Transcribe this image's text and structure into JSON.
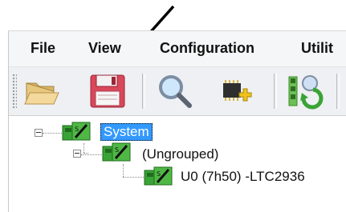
{
  "menu": {
    "file": "File",
    "view": "View",
    "configuration": "Configuration",
    "utilities": "Utilit"
  },
  "toolbar": {
    "buttons": [
      {
        "icon": "open-folder-icon"
      },
      {
        "icon": "floppy-disk-save-icon"
      },
      {
        "icon": "magnifier-search-icon"
      },
      {
        "icon": "add-device-chip-icon"
      },
      {
        "icon": "refresh-network-icon"
      }
    ]
  },
  "tree": {
    "root": {
      "label": "System",
      "selected": true
    },
    "group": {
      "label": "(Ungrouped)"
    },
    "device": {
      "label": "U0 (7h50) -LTC2936"
    }
  },
  "colors": {
    "selection": "#3399ff",
    "device_green": "#3aa335"
  }
}
